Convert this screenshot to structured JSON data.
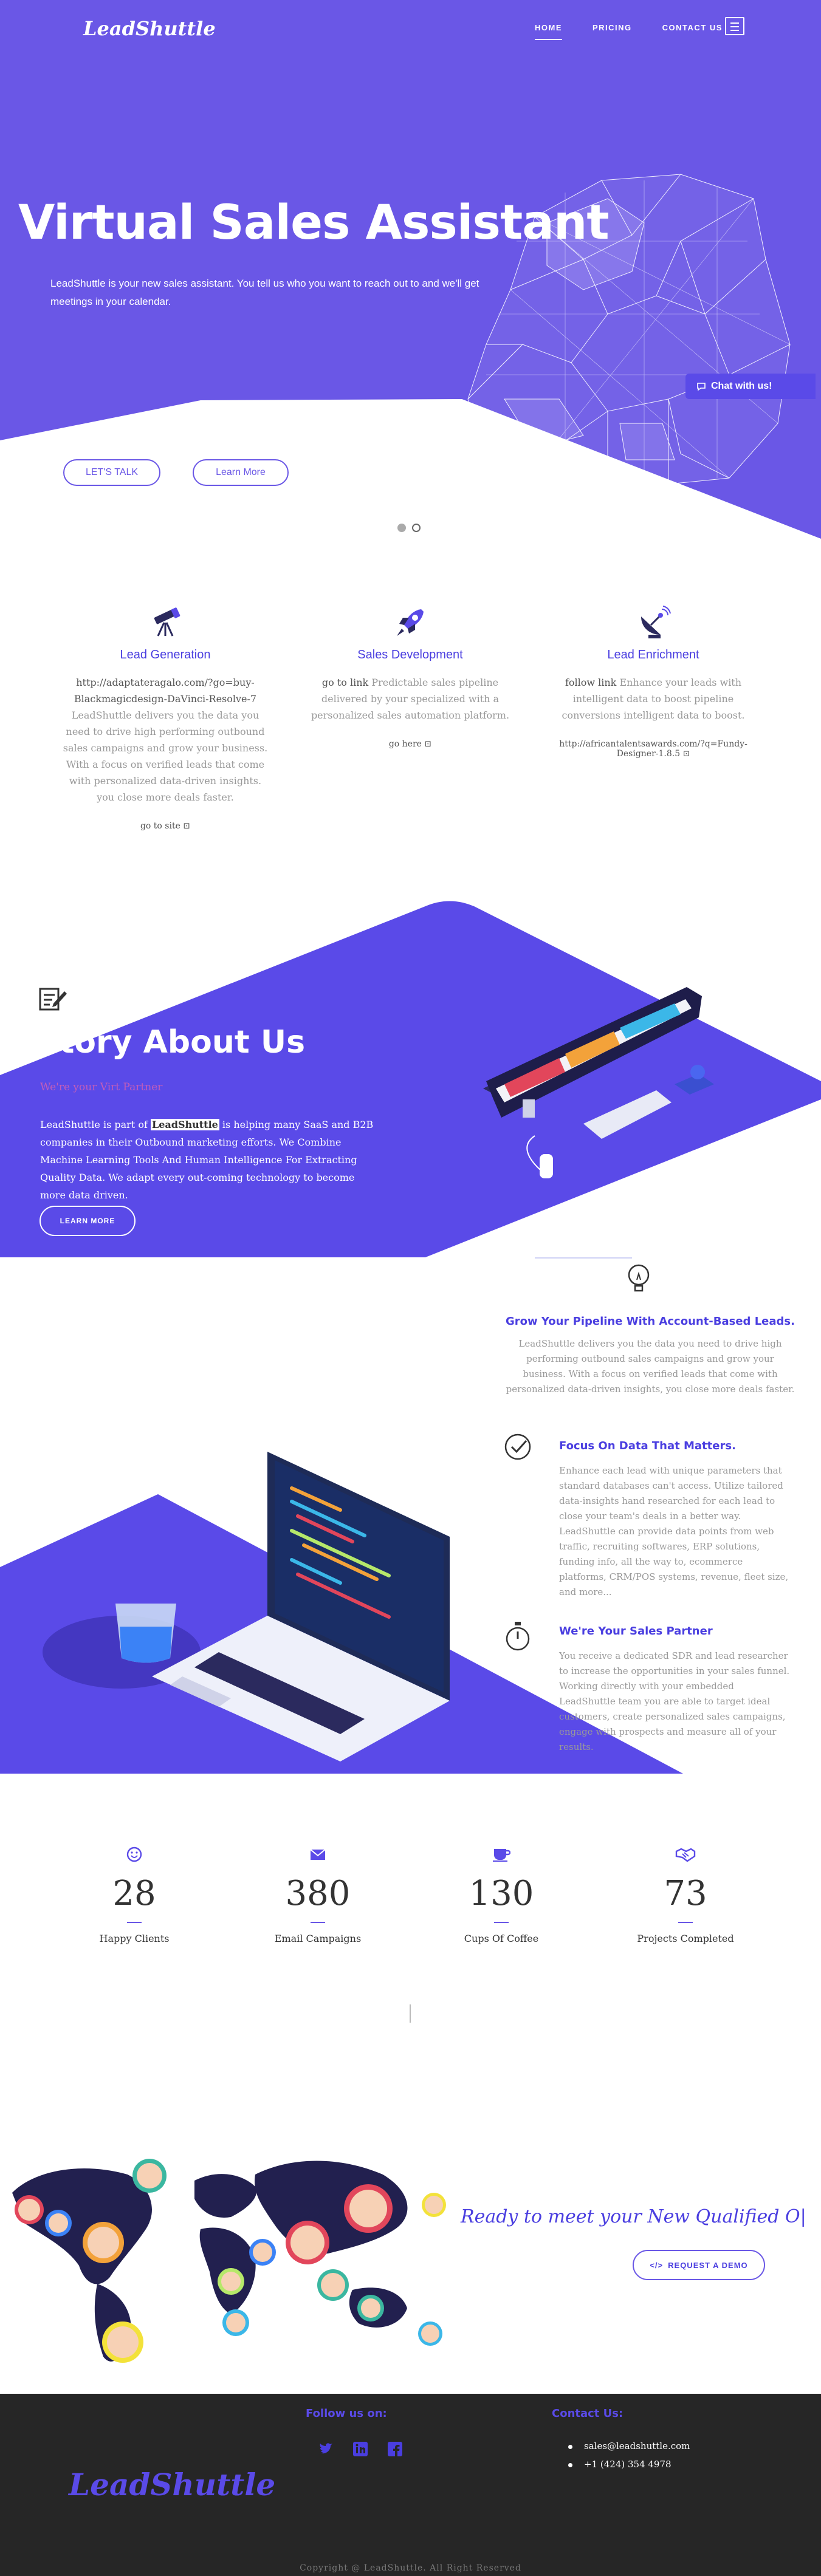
{
  "nav": {
    "logo": "LeadShuttle",
    "links": [
      "HOME",
      "PRICING",
      "CONTACT US"
    ]
  },
  "hero": {
    "title": "Virtual Sales Assistant",
    "subtitle": "LeadShuttle is your new sales assistant. You tell us who you want to reach out to and we'll get meetings in your calendar.",
    "chat_label": "Chat with us!",
    "btn_talk": "LET'S TALK",
    "btn_learn": "Learn More"
  },
  "services": [
    {
      "title": "Lead Generation",
      "link_text": "http://adaptateragalo.com/?go=buy-Blackmagicdesign-DaVinci-Resolve-7",
      "text": "LeadShuttle delivers you the data you need to drive high performing outbound sales campaigns and grow your business. With a focus on verified leads that come with personalized data-driven insights. you close more deals faster.",
      "cta": "go to site"
    },
    {
      "title": "Sales Development",
      "link_text": "go to link",
      "text": "Predictable sales pipeline delivered by your specialized with a personalized sales automation platform.",
      "cta": "go here"
    },
    {
      "title": "Lead Enrichment",
      "link_text": "follow link",
      "text": "Enhance your leads with intelligent data to boost pipeline conversions intelligent data to boost.",
      "cta": "http://africantalentsawards.com/?q=Fundy-Designer-1.8.5"
    }
  ],
  "story": {
    "title": "Story About Us",
    "subtitle": "We're your Virt Partner",
    "text_pre": "LeadShuttle is part of",
    "text_brand": "LeadShuttle",
    "text_post": "is helping many SaaS and B2B companies in their Outbound marketing efforts. We Combine Machine Learning Tools And Human Intelligence For Extracting Quality Data. We adapt every out-coming technology to become more data driven.",
    "button": "LEARN MORE"
  },
  "features": [
    {
      "title": "Grow Your Pipeline With Account-Based Leads.",
      "text": "LeadShuttle delivers you the data you need to drive high performing outbound sales campaigns and grow your business. With a focus on verified leads that come with personalized data-driven insights, you close more deals faster."
    },
    {
      "title": "Focus On Data That Matters.",
      "text": "Enhance each lead with unique parameters that standard databases can't access. Utilize tailored data-insights hand researched for each lead to close your team's deals in a better way. LeadShuttle can provide data points from web traffic, recruiting softwares, ERP solutions, funding info, all the way to, ecommerce platforms, CRM/POS systems, revenue, fleet size, and more..."
    },
    {
      "title": "We're Your Sales Partner",
      "text": "You receive a dedicated SDR and lead researcher to increase the opportunities in your sales funnel. Working directly with your embedded LeadShuttle team you are able to target ideal customers, create personalized sales campaigns, engage with prospects and measure all of your results."
    }
  ],
  "counters": [
    {
      "value": "28",
      "label": "Happy Clients",
      "icon": "smile-icon"
    },
    {
      "value": "380",
      "label": "Email Campaigns",
      "icon": "envelope-icon"
    },
    {
      "value": "130",
      "label": "Cups Of Coffee",
      "icon": "coffee-icon"
    },
    {
      "value": "73",
      "label": "Projects Completed",
      "icon": "handshake-icon"
    }
  ],
  "cta": {
    "title": "Ready to meet your New Qualified O|",
    "button": "REQUEST A DEMO"
  },
  "footer": {
    "follow": "Follow us on:",
    "contact": "Contact Us:",
    "logo": "LeadShuttle",
    "email": "sales@leadshuttle.com",
    "phone": "+1 (424) 354 4978",
    "copyright": "Copyright @ LeadShuttle. All Right Reserved"
  },
  "colors": {
    "brand": "#6a57e6",
    "brand_dark": "#4a3ee0",
    "footer_bg": "#262626"
  }
}
